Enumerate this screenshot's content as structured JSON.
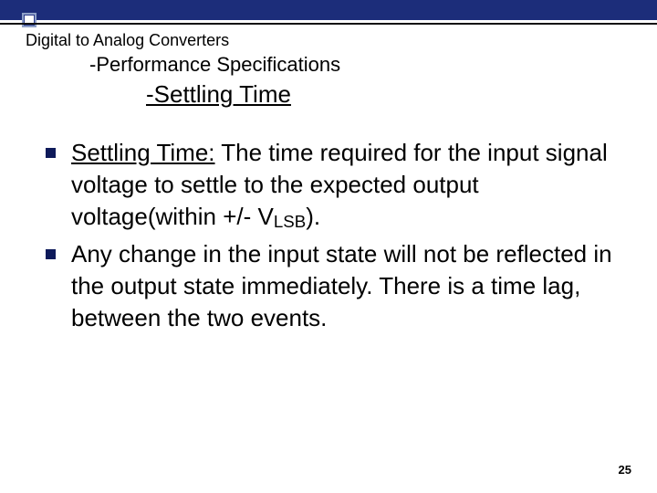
{
  "header": {
    "breadcrumb": "Digital to Analog Converters",
    "subcrumb": "-Performance Specifications",
    "subtitle": "-Settling Time"
  },
  "bullets": [
    {
      "term": "Settling Time:",
      "text_before_sub": "  The time required for the input signal voltage to settle to  the expected output voltage(within +/- V",
      "sub": "LSB",
      "text_after_sub": ")."
    },
    {
      "term": "",
      "text_before_sub": "Any change in the input state will not be reflected in the output state immediately. There is a time lag, between the two events.",
      "sub": "",
      "text_after_sub": ""
    }
  ],
  "page_number": "25"
}
